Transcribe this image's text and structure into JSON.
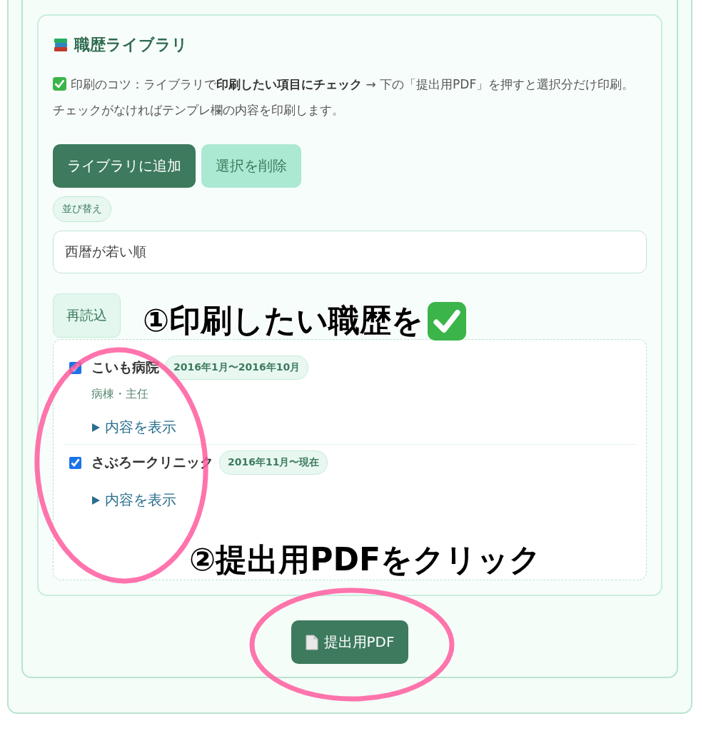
{
  "library": {
    "title": "職歴ライブラリ",
    "tip": "印刷のコツ：ライブラリで**印刷したい項目にチェック** → 下の「提出用PDF」を押すと選択分だけ印刷。",
    "tip_note": "チェックがなければテンプレ欄の内容を印刷します。",
    "buttons": [
      {
        "label": "ライブラリに追加",
        "kind": "primary"
      },
      {
        "label": "選択を削除",
        "kind": "secondary"
      }
    ],
    "sort": {
      "label": "並び替え",
      "value": "西暦が若い順"
    },
    "reload": "再読込",
    "entries": [
      {
        "name": "こいも病院",
        "period": "2016年1月〜2016年10月",
        "role": "病棟・主任",
        "checked": true,
        "toggle": "内容を表示"
      },
      {
        "name": "さぶろークリニック",
        "period": "2016年11月〜現在",
        "checked": true,
        "toggle": "内容を表示"
      }
    ]
  },
  "pdf_button": "提出用PDF",
  "annotations": [
    {
      "text": "①印刷したい職歴を",
      "check": true
    },
    {
      "text": "②提出用PDFをクリック",
      "check": false
    }
  ]
}
